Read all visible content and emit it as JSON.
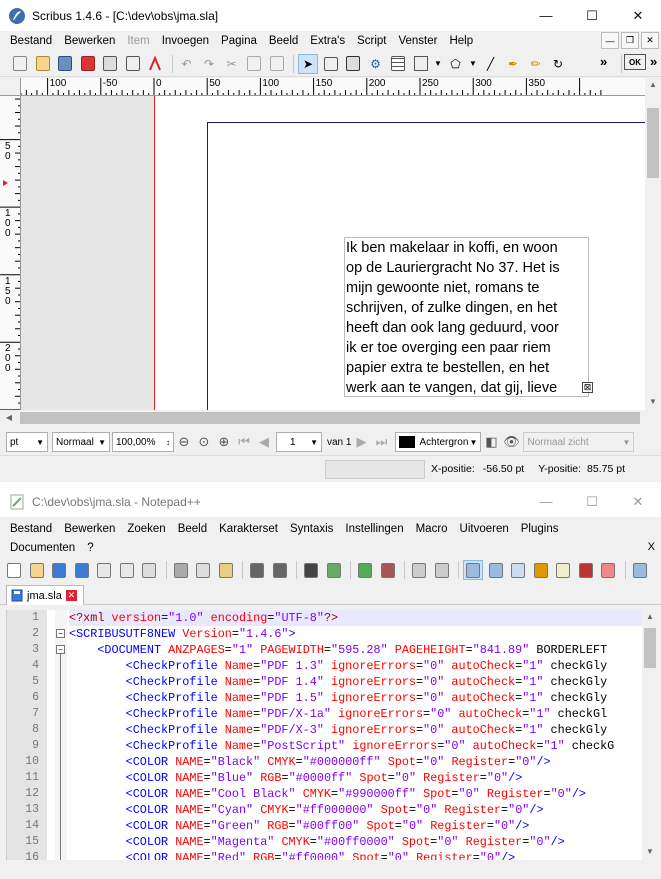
{
  "scribus": {
    "title": "Scribus 1.4.6 - [C:\\dev\\obs\\jma.sla]",
    "menu": [
      {
        "label": "Bestand",
        "disabled": false
      },
      {
        "label": "Bewerken",
        "disabled": false
      },
      {
        "label": "Item",
        "disabled": true
      },
      {
        "label": "Invoegen",
        "disabled": false
      },
      {
        "label": "Pagina",
        "disabled": false
      },
      {
        "label": "Beeld",
        "disabled": false
      },
      {
        "label": "Extra's",
        "disabled": false
      },
      {
        "label": "Script",
        "disabled": false
      },
      {
        "label": "Venster",
        "disabled": false
      },
      {
        "label": "Help",
        "disabled": false
      }
    ],
    "hruler_labels": [
      "100",
      "-50",
      "0",
      "50",
      "100",
      "150",
      "200",
      "250",
      "300",
      "350"
    ],
    "vruler_labels": [
      "50",
      "100",
      "150",
      "200"
    ],
    "text_frame_lines": [
      "Ik ben makelaar in koffi, en woon",
      "op de Lauriergracht No 37. Het is",
      "mijn gewoonte niet, romans te",
      "schrijven, of zulke dingen, en het",
      "heeft dan ook lang geduurd, voor",
      "ik er toe overging een paar riem",
      "papier extra te bestellen, en het",
      "werk aan te vangen, dat gij, lieve"
    ],
    "unit": "pt",
    "mode": "Normaal",
    "zoom": "100,00%",
    "page_number": "1",
    "page_of": "van 1",
    "layer": "Achtergron",
    "view_mode": "Normaal zicht",
    "x_label": "X-positie:",
    "x_value": "-56.50 pt",
    "y_label": "Y-positie:",
    "y_value": "85.75 pt",
    "colors": {
      "accent_red": "#dd2222",
      "guide_blue": "#1a1a7a"
    }
  },
  "notepad": {
    "title": "C:\\dev\\obs\\jma.sla - Notepad++",
    "menu": [
      "Bestand",
      "Bewerken",
      "Zoeken",
      "Beeld",
      "Karakterset",
      "Syntaxis",
      "Instellingen",
      "Macro",
      "Uitvoeren",
      "Plugins"
    ],
    "menu2": [
      "Documenten",
      "?"
    ],
    "close_x": "X",
    "tab": "jma.sla",
    "line_numbers": [
      "1",
      "2",
      "3",
      "4",
      "5",
      "6",
      "7",
      "8",
      "9",
      "10",
      "11",
      "12",
      "13",
      "14",
      "15",
      "16"
    ],
    "code_lines": [
      "<?xml version=\"1.0\" encoding=\"UTF-8\"?>",
      "<SCRIBUSUTF8NEW Version=\"1.4.6\">",
      "    <DOCUMENT ANZPAGES=\"1\" PAGEWIDTH=\"595.28\" PAGEHEIGHT=\"841.89\" BORDERLEFT",
      "        <CheckProfile Name=\"PDF 1.3\" ignoreErrors=\"0\" autoCheck=\"1\" checkGly",
      "        <CheckProfile Name=\"PDF 1.4\" ignoreErrors=\"0\" autoCheck=\"1\" checkGly",
      "        <CheckProfile Name=\"PDF 1.5\" ignoreErrors=\"0\" autoCheck=\"1\" checkGly",
      "        <CheckProfile Name=\"PDF/X-1a\" ignoreErrors=\"0\" autoCheck=\"1\" checkGl",
      "        <CheckProfile Name=\"PDF/X-3\" ignoreErrors=\"0\" autoCheck=\"1\" checkGly",
      "        <CheckProfile Name=\"PostScript\" ignoreErrors=\"0\" autoCheck=\"1\" checkG",
      "        <COLOR NAME=\"Black\" CMYK=\"#000000ff\" Spot=\"0\" Register=\"0\"/>",
      "        <COLOR NAME=\"Blue\" RGB=\"#0000ff\" Spot=\"0\" Register=\"0\"/>",
      "        <COLOR NAME=\"Cool Black\" CMYK=\"#990000ff\" Spot=\"0\" Register=\"0\"/>",
      "        <COLOR NAME=\"Cyan\" CMYK=\"#ff000000\" Spot=\"0\" Register=\"0\"/>",
      "        <COLOR NAME=\"Green\" RGB=\"#00ff00\" Spot=\"0\" Register=\"0\"/>",
      "        <COLOR NAME=\"Magenta\" CMYK=\"#00ff0000\" Spot=\"0\" Register=\"0\"/>",
      "        <COLOR NAME=\"Red\" RGB=\"#ff0000\" Spot=\"0\" Register=\"0\"/>"
    ],
    "colors": {
      "tag": "#0000ff",
      "attr": "#ff0000",
      "value": "#8000ff"
    }
  }
}
